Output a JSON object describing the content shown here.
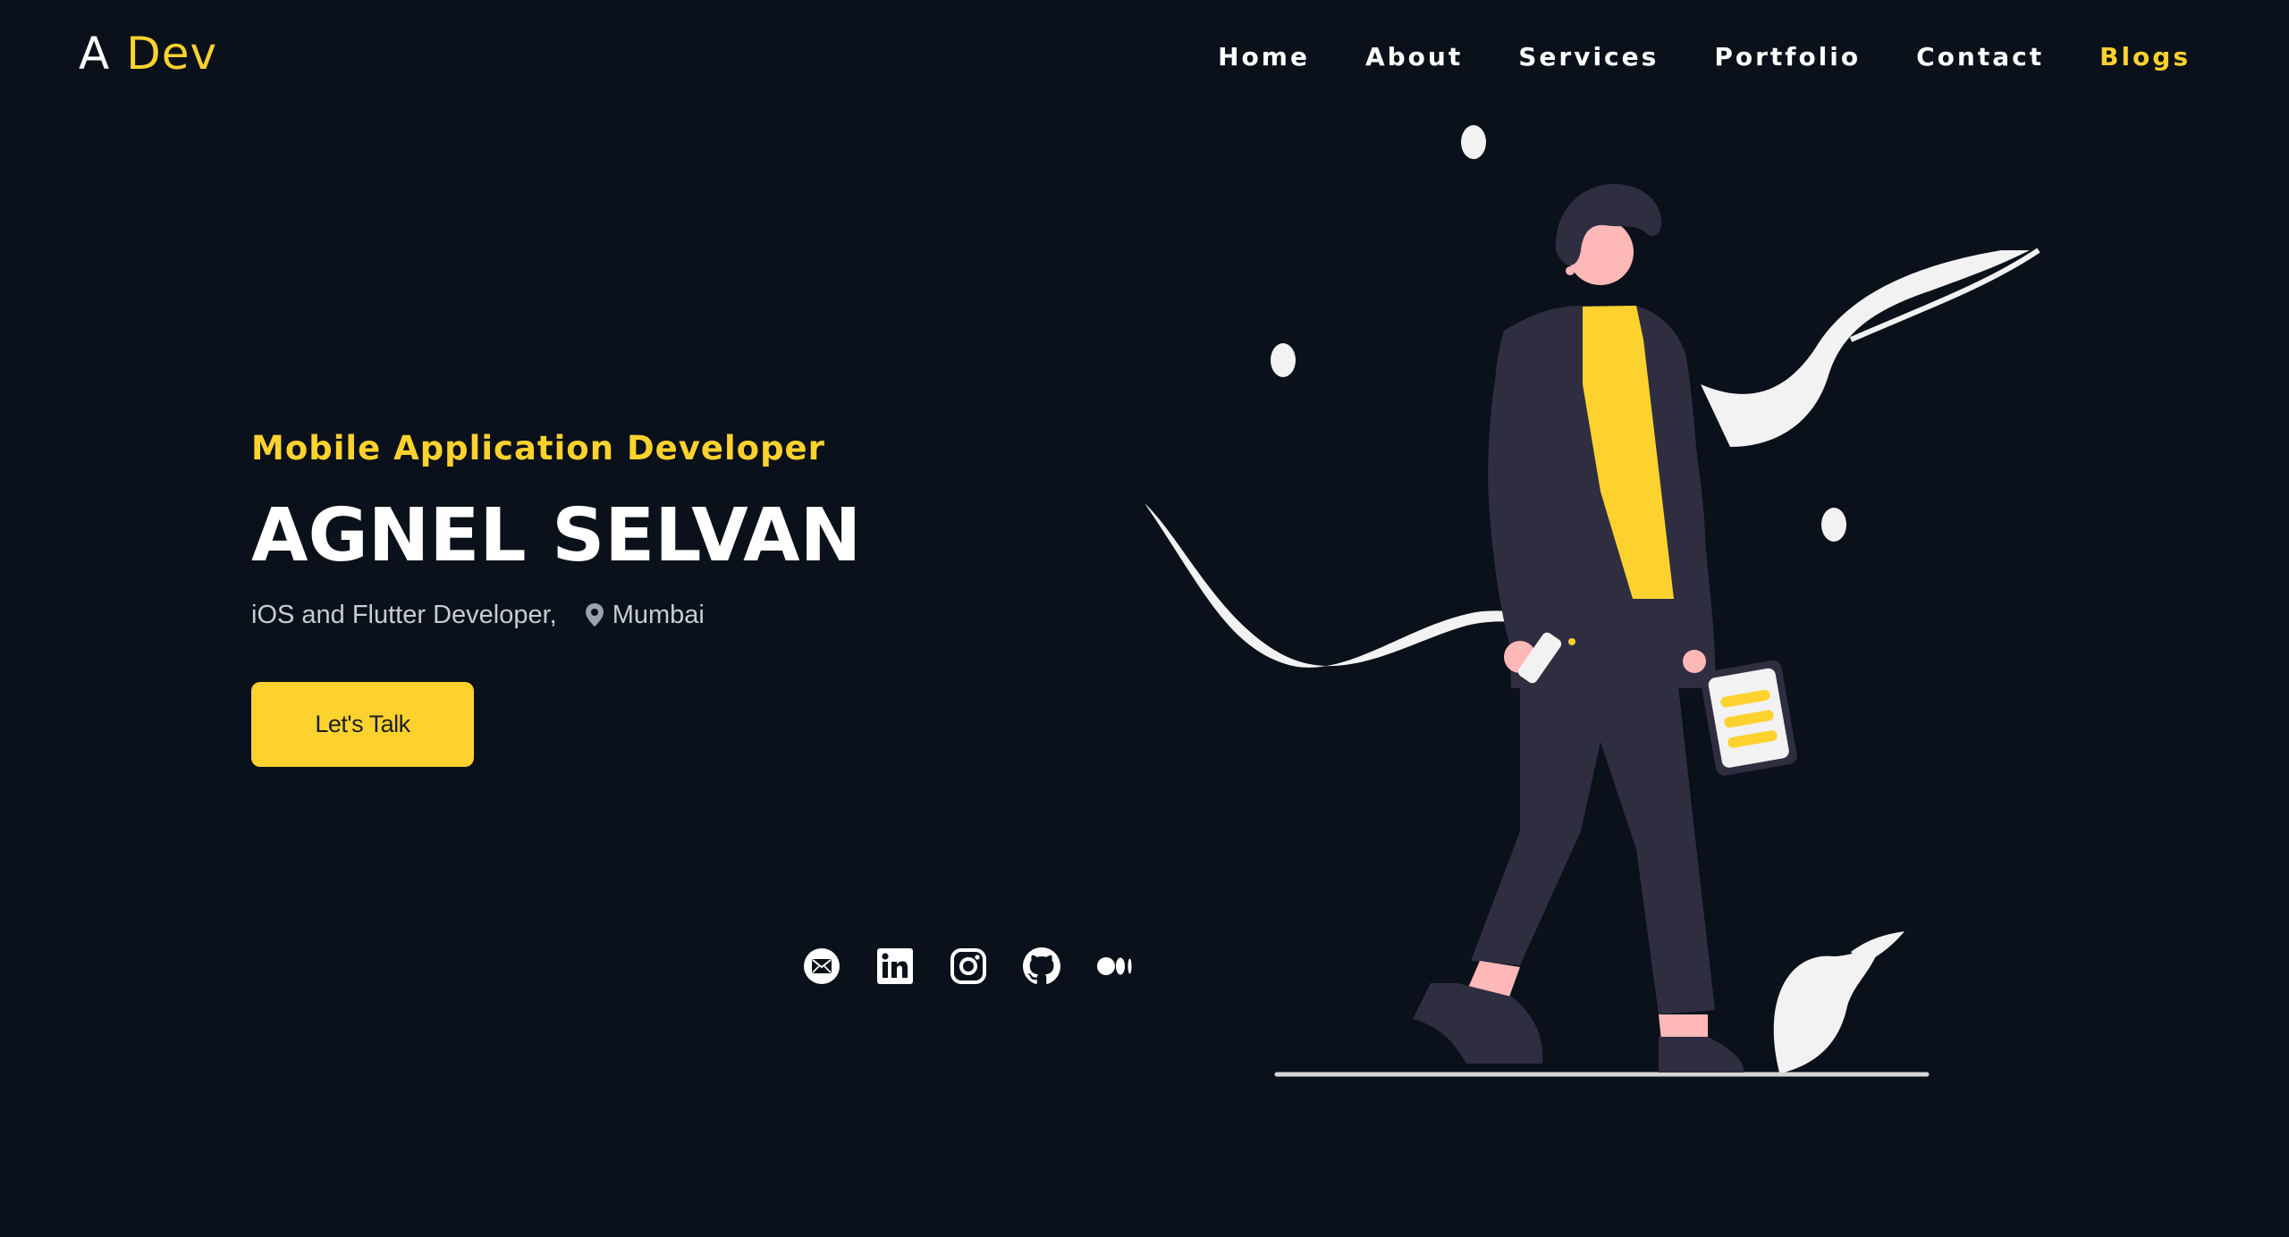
{
  "logo": {
    "initial": "A",
    "word": "Dev"
  },
  "nav": {
    "items": [
      {
        "label": "Home"
      },
      {
        "label": "About"
      },
      {
        "label": "Services"
      },
      {
        "label": "Portfolio"
      },
      {
        "label": "Contact"
      },
      {
        "label": "Blogs"
      }
    ],
    "active": "Blogs"
  },
  "hero": {
    "role": "Mobile Application Developer",
    "name": "AGNEL SELVAN",
    "subtitle": "iOS and Flutter Developer,",
    "location": "Mumbai",
    "cta_label": "Let's Talk"
  },
  "socials": [
    {
      "icon": "email-icon"
    },
    {
      "icon": "linkedin-icon"
    },
    {
      "icon": "instagram-icon"
    },
    {
      "icon": "github-icon"
    },
    {
      "icon": "medium-icon"
    }
  ],
  "colors": {
    "background": "#0a111a",
    "accent": "#fdd22e",
    "text": "#ffffff",
    "muted": "#c6ccd3",
    "figure_dark": "#2f2e41",
    "skin": "#ffb8b8",
    "shape_light": "#f2f2f2"
  }
}
